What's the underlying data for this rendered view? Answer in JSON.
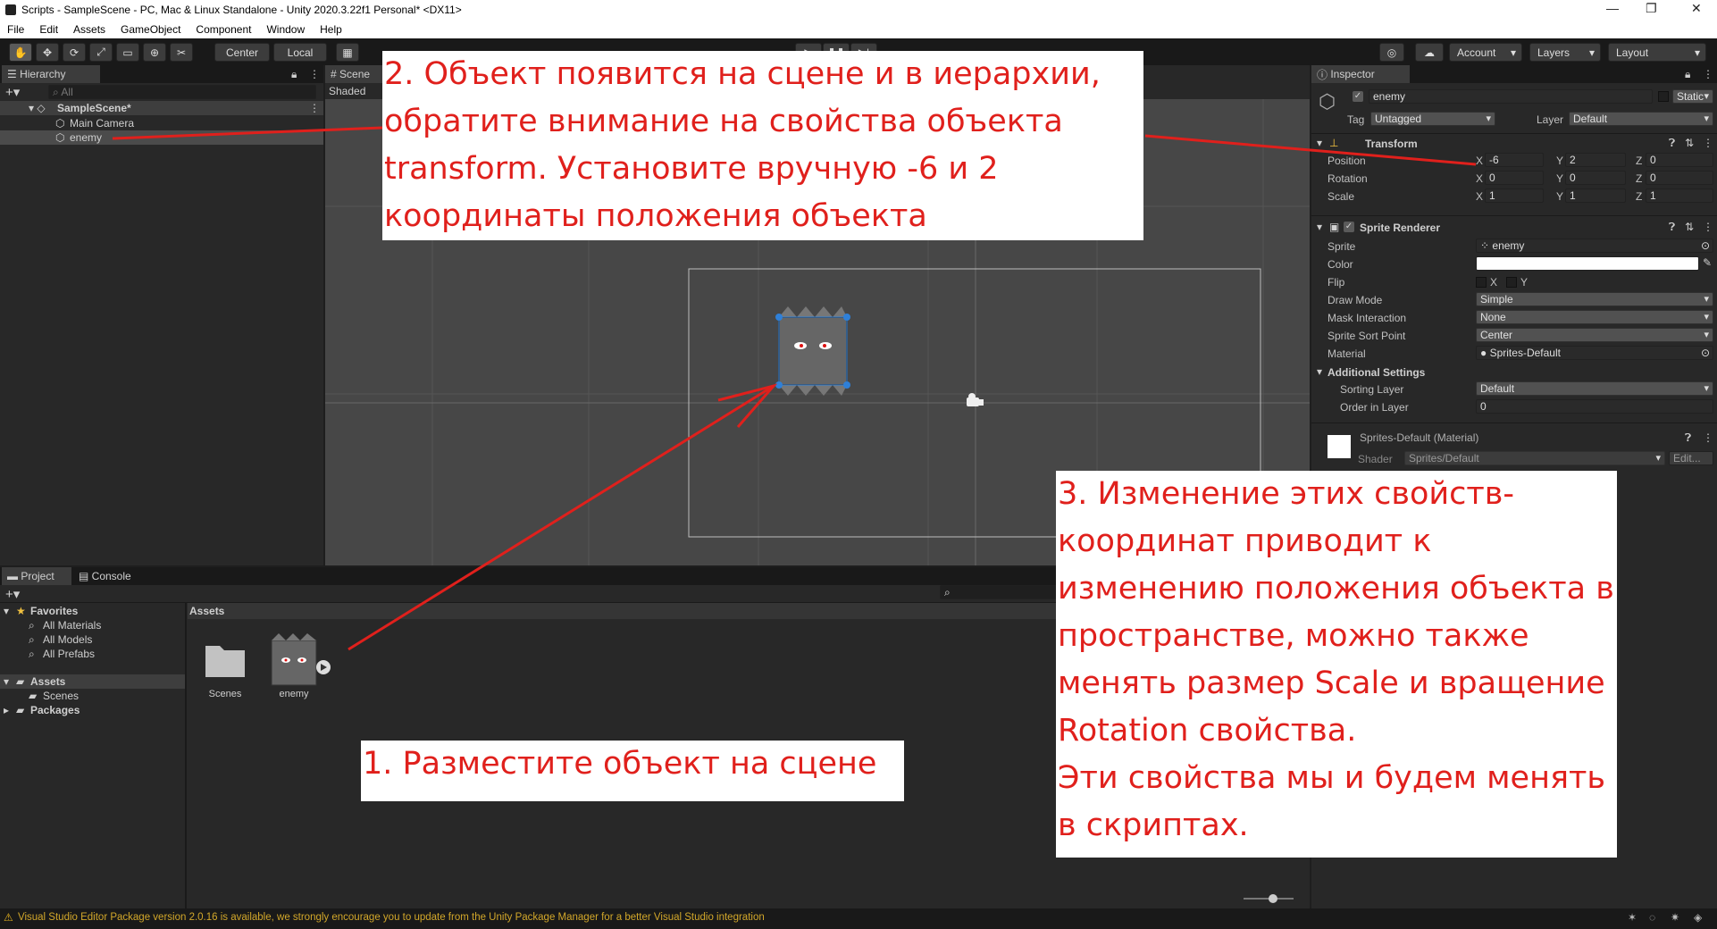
{
  "window": {
    "title": "Scripts - SampleScene - PC, Mac & Linux Standalone - Unity 2020.3.22f1 Personal* <DX11>",
    "controls": [
      "—",
      "❐",
      "✕"
    ]
  },
  "menu": [
    "File",
    "Edit",
    "Assets",
    "GameObject",
    "Component",
    "Window",
    "Help"
  ],
  "toolbar": {
    "pivot": "Center",
    "space": "Local",
    "account": "Account",
    "layers": "Layers",
    "layout": "Layout"
  },
  "hierarchy": {
    "tab": "Hierarchy",
    "search_placeholder": "All",
    "scene": "SampleScene*",
    "items": [
      "Main Camera",
      "enemy"
    ]
  },
  "scene": {
    "tab": "Scene",
    "shading": "Shaded"
  },
  "project": {
    "tabs": [
      "Project",
      "Console"
    ],
    "favorites_header": "Favorites",
    "favorites": [
      "All Materials",
      "All Models",
      "All Prefabs"
    ],
    "assets_header": "Assets",
    "assets_children": [
      "Scenes"
    ],
    "packages": "Packages",
    "breadcrumb": "Assets",
    "grid_items": [
      "Scenes",
      "enemy"
    ]
  },
  "inspector": {
    "tab": "Inspector",
    "object_name": "enemy",
    "static_label": "Static",
    "tag_label": "Tag",
    "tag_value": "Untagged",
    "layer_label": "Layer",
    "layer_value": "Default",
    "transform": {
      "title": "Transform",
      "rows": [
        {
          "label": "Position",
          "x": "-6",
          "y": "2",
          "z": "0"
        },
        {
          "label": "Rotation",
          "x": "0",
          "y": "0",
          "z": "0"
        },
        {
          "label": "Scale",
          "x": "1",
          "y": "1",
          "z": "1"
        }
      ]
    },
    "sprite_renderer": {
      "title": "Sprite Renderer",
      "sprite_label": "Sprite",
      "sprite_value": "enemy",
      "color_label": "Color",
      "color_value": "#ffffff",
      "flip_label": "Flip",
      "flip_x": "X",
      "flip_y": "Y",
      "draw_mode_label": "Draw Mode",
      "draw_mode_value": "Simple",
      "mask_label": "Mask Interaction",
      "mask_value": "None",
      "sort_point_label": "Sprite Sort Point",
      "sort_point_value": "Center",
      "material_label": "Material",
      "material_value": "Sprites-Default",
      "additional": "Additional Settings",
      "sorting_layer_label": "Sorting Layer",
      "sorting_layer_value": "Default",
      "order_label": "Order in Layer",
      "order_value": "0"
    },
    "material": {
      "title": "Sprites-Default (Material)",
      "shader_label": "Shader",
      "shader_value": "Sprites/Default",
      "edit": "Edit..."
    }
  },
  "status": "Visual Studio Editor Package version 2.0.16 is available, we strongly encourage you to update from the Unity Package Manager for a better Visual Studio integration",
  "annotations": {
    "step1": "1. Разместите объект на сцене",
    "step2": [
      "2. Объект появится на сцене и в иерархии,",
      "обратите внимание на свойства объекта",
      "transform. Установите вручную -6 и 2",
      "координаты положения объекта"
    ],
    "step3": [
      "3. Изменение этих свойств-",
      "координат приводит к",
      "изменению положения объекта в",
      "пространстве, можно также",
      "менять размер Scale и вращение",
      "Rotation свойства.",
      "Эти свойства мы и будем менять",
      "в скриптах."
    ]
  },
  "colors": {
    "annotation": "#e0201c",
    "selection": "#2c5d87",
    "accent_blue": "#3a79bb"
  }
}
